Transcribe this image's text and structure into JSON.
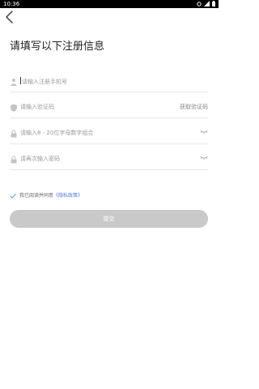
{
  "status": {
    "time": "10:36"
  },
  "page": {
    "title": "请填写以下注册信息"
  },
  "form": {
    "phone": {
      "placeholder": "请输入注册手机号"
    },
    "code": {
      "placeholder": "请输入验证码",
      "action": "获取验证码"
    },
    "password": {
      "placeholder": "请输入8 - 20位字母数字组合"
    },
    "confirm": {
      "placeholder": "请再次输入密码"
    }
  },
  "agreement": {
    "text": "我已阅读并同意",
    "link": "《隐私政策》"
  },
  "submit": {
    "label": "提交"
  },
  "colors": {
    "link": "#4a7ee0",
    "button": "#c9c9c9",
    "check": "#6aa0e6"
  },
  "icons": [
    "back-arrow-icon",
    "person-icon",
    "shield-icon",
    "lock-icon",
    "eye-closed-icon",
    "checkmark-icon"
  ]
}
